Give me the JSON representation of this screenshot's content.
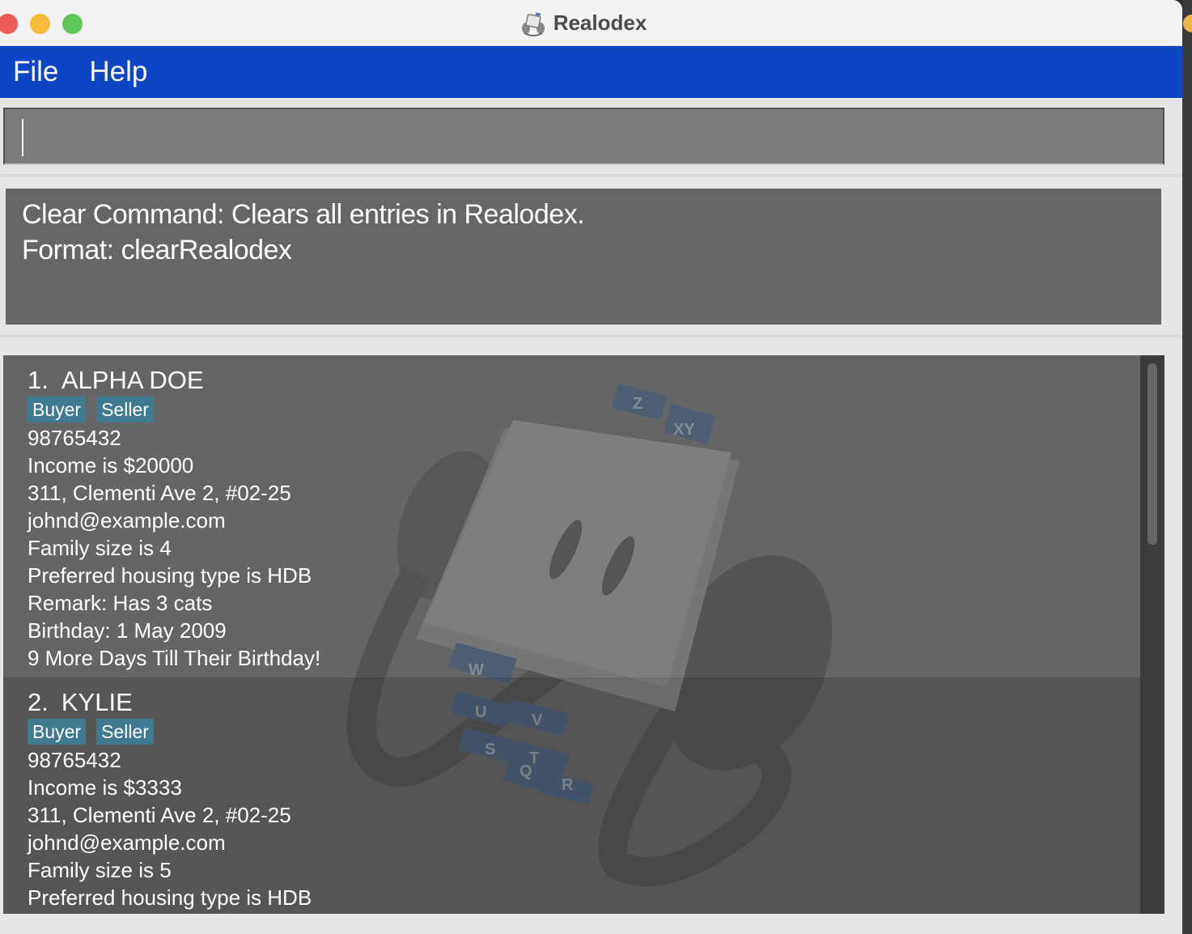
{
  "window": {
    "title": "Realodex"
  },
  "menu": {
    "items": [
      "File",
      "Help"
    ]
  },
  "command_box": {
    "value": "",
    "placeholder": ""
  },
  "result_display": {
    "lines": [
      "Clear Command: Clears all entries in Realodex.",
      "Format: clearRealodex"
    ]
  },
  "persons": [
    {
      "index": "1.",
      "name": "ALPHA DOE",
      "tags": [
        "Buyer",
        "Seller"
      ],
      "fields": [
        "98765432",
        "Income is $20000",
        "311, Clementi Ave 2, #02-25",
        "johnd@example.com",
        "Family size is 4",
        "Preferred housing type is HDB",
        "Remark: Has 3 cats",
        "Birthday: 1 May 2009",
        "9 More Days Till Their Birthday!"
      ]
    },
    {
      "index": "2.",
      "name": "KYLIE",
      "tags": [
        "Buyer",
        "Seller"
      ],
      "fields": [
        "98765432",
        "Income is $3333",
        "311, Clementi Ave 2, #02-25",
        "johnd@example.com",
        "Family size is 5",
        "Preferred housing type is HDB"
      ]
    }
  ],
  "watermark_tabs": [
    "Z",
    "XY",
    "W",
    "U",
    "V",
    "S",
    "T",
    "Q",
    "R"
  ],
  "colors": {
    "menubar": "#0d46c5",
    "tag": "#3e7b91",
    "result_bg": "#666666",
    "list_bg": "#555555"
  },
  "icons": {
    "app": "rolodex-icon",
    "watermark": "rolodex-watermark"
  }
}
